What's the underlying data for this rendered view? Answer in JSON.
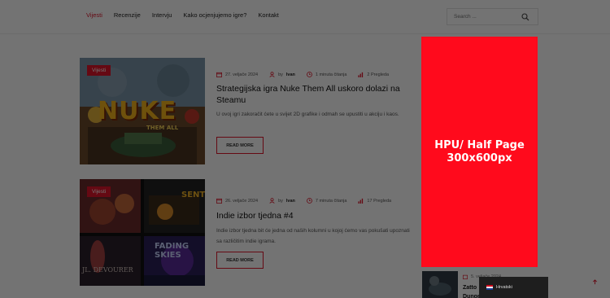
{
  "nav": {
    "items": [
      "Vijesti",
      "Recenzije",
      "Intervju",
      "Kako ocjenjujemo igre?",
      "Kontakt"
    ]
  },
  "search": {
    "placeholder": "Search ..."
  },
  "posts": [
    {
      "category": "Vijesti",
      "date": "27. veljače 2024",
      "by": "by",
      "author": "Ivan",
      "read_time": "1 minuta čitanja",
      "views": "2 Pregleda",
      "title": "Strategijska igra Nuke Them All uskoro dolazi na Steamu",
      "excerpt": "U ovoj igri zakoračit ćete u svijet 2D grafike i odmah se upustiti u akciju i kaos.",
      "button": "READ MORE",
      "thumb_text_1": "NUKE",
      "thumb_text_2": "THEM ALL"
    },
    {
      "category": "Vijesti",
      "date": "26. veljače 2024",
      "by": "by",
      "author": "Ivan",
      "read_time": "7 minuta čitanja",
      "views": "17 Pregleda",
      "title": "Indie izbor tjedna #4",
      "excerpt": "Indie izbor tjedna bit će jedna od naših kolumni u kojoj ćemo vas pokušati upoznati sa različitim indie igrama.",
      "button": "READ MORE",
      "thumb_text_1": "SENT",
      "thumb_text_2": "FADING SKIES",
      "thumb_text_3": "JL. DEVOURER"
    }
  ],
  "ad": {
    "line1": "HPU/ Half Page",
    "line2": "300x600px"
  },
  "sidebar_post": {
    "date": "5. veljače 2024",
    "title": "Zatto Dunge"
  },
  "language": {
    "label": "Hrvatski"
  },
  "colors": {
    "accent": "#e0162b",
    "ad": "#ff0a1c",
    "overlay": "rgba(0,0,0,0.55)"
  }
}
